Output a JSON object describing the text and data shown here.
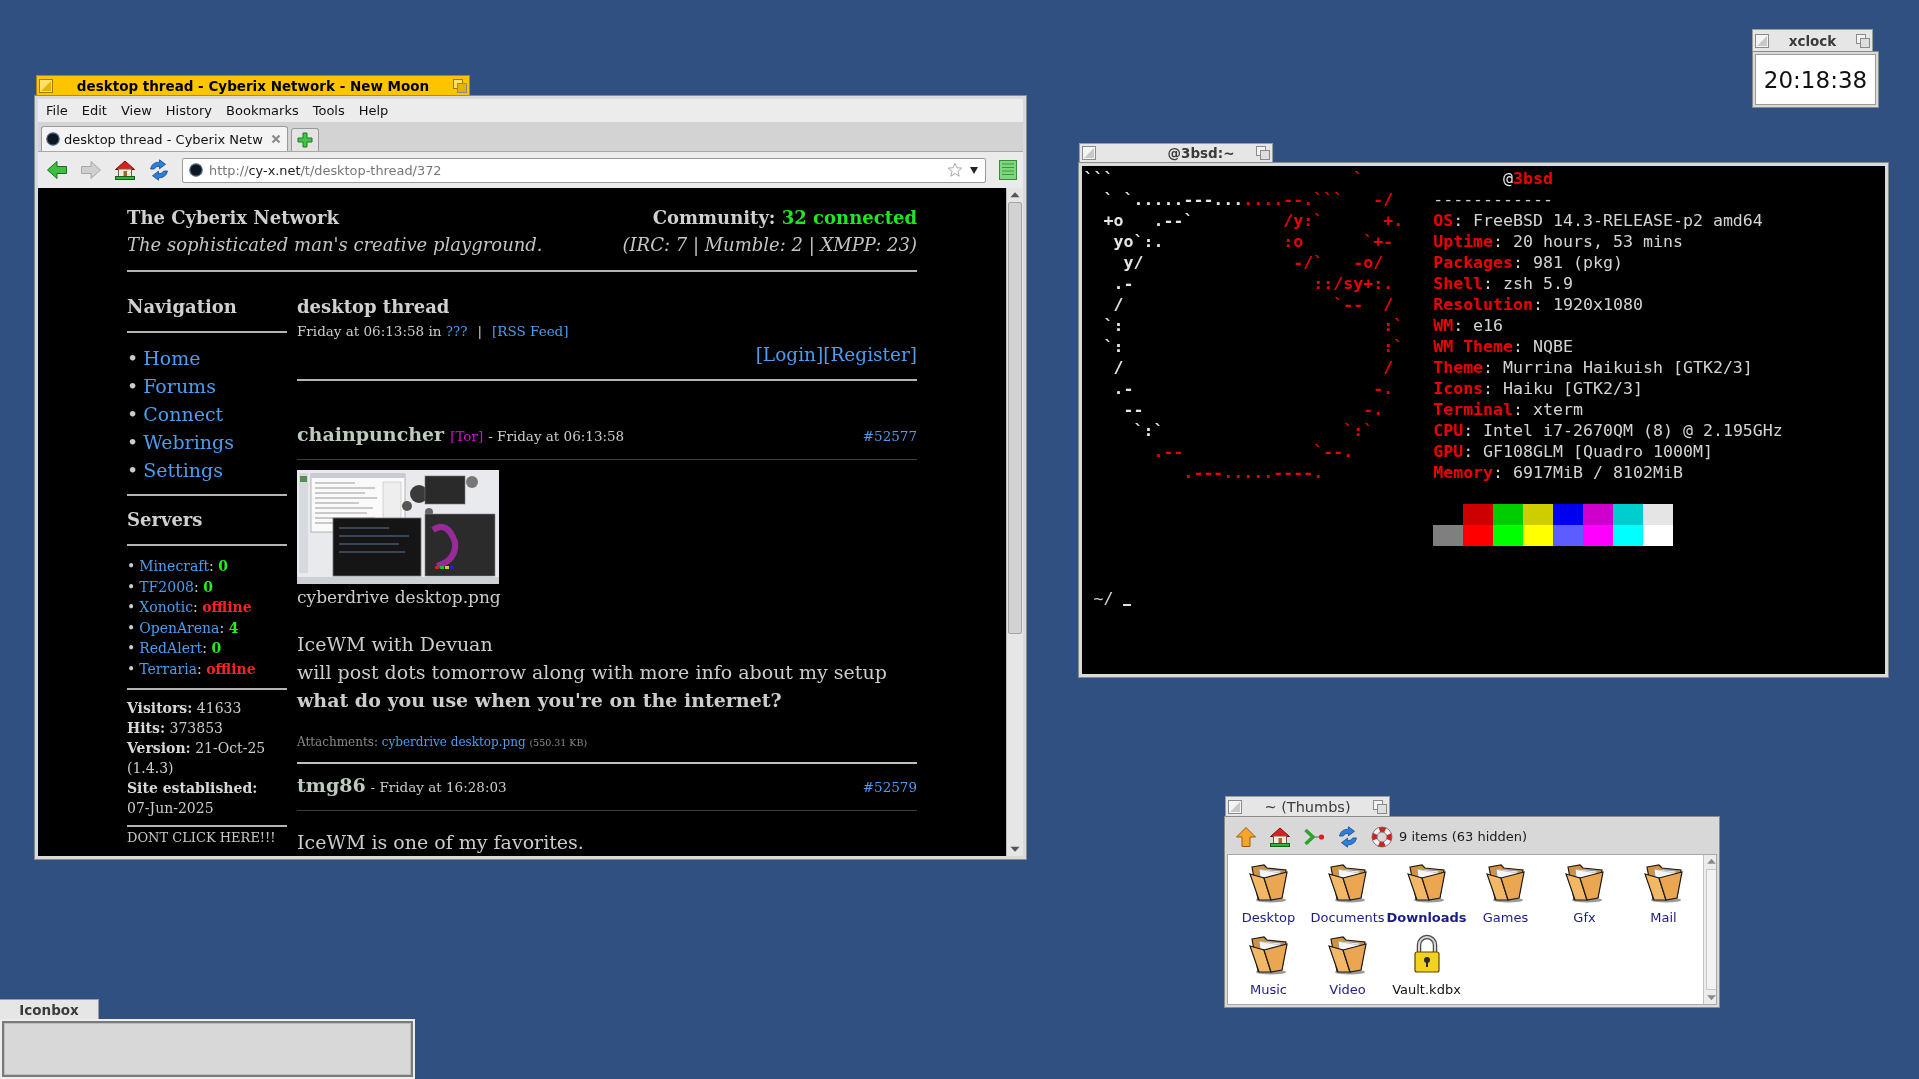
{
  "browser": {
    "focused": true,
    "title": "desktop thread - Cyberix Network - New Moon",
    "menu": [
      "File",
      "Edit",
      "View",
      "History",
      "Bookmarks",
      "Tools",
      "Help"
    ],
    "tabs": [
      {
        "label": "desktop thread - Cyberix Netw",
        "selected": true
      }
    ],
    "toolbar": [
      {
        "kind": "back",
        "disabled": false
      },
      {
        "kind": "forward",
        "disabled": true
      },
      {
        "kind": "home",
        "disabled": false
      },
      {
        "kind": "reload",
        "disabled": false
      }
    ],
    "address": {
      "scheme": "http://",
      "host": "cy-x.net",
      "path": "/t/desktop-thread/372"
    },
    "page": {
      "site_title": "The Cyberix Network",
      "tagline": "The sophisticated man's creative playground.",
      "community_label": "Community:",
      "community_count": "32 connected",
      "community_detail": "(IRC: 7 | Mumble: 2 | XMPP: 23)",
      "navigation": {
        "heading": "Navigation",
        "bullet": "•",
        "items": [
          "Home",
          "Forums",
          "Connect",
          "Webrings",
          "Settings"
        ]
      },
      "servers": {
        "heading": "Servers",
        "bullet": "•",
        "separator": ":",
        "items": [
          {
            "name": "Minecraft",
            "status": "0",
            "online": true
          },
          {
            "name": "TF2008",
            "status": "0",
            "online": true
          },
          {
            "name": "Xonotic",
            "status": "offline",
            "online": false
          },
          {
            "name": "OpenArena",
            "status": "4",
            "online": true
          },
          {
            "name": "RedAlert",
            "status": "0",
            "online": true
          },
          {
            "name": "Terraria",
            "status": "offline",
            "online": false
          }
        ]
      },
      "stats": [
        {
          "label": "Visitors:",
          "value": "41633"
        },
        {
          "label": "Hits:",
          "value": "373853"
        },
        {
          "label": "Version:",
          "value": "21-Oct-25 (1.4.3)"
        },
        {
          "label": "Site established:",
          "value": "07-Jun-2025"
        }
      ],
      "footer_link": "DONT CLICK HERE!!!",
      "thread": {
        "title": "desktop thread",
        "posted": "Friday at 06:13:58 in",
        "category": "???",
        "separator": "|",
        "feed": "[RSS Feed]",
        "login": "[Login]",
        "register": "[Register]"
      },
      "posts": [
        {
          "author": "chainpuncher",
          "tag": "[Tor]",
          "time": "- Friday at 06:13:58",
          "number": "#52577",
          "image": {
            "caption": "cyberdrive desktop.png"
          },
          "lines": [
            {
              "text": "IceWM with Devuan",
              "bold": false
            },
            {
              "text": "will post dots tomorrow along with more info about my setup",
              "bold": false
            },
            {
              "text": "what do you use when you're on the internet?",
              "bold": true
            }
          ],
          "attachments": {
            "label": "Attachments:",
            "file": "cyberdrive desktop.png",
            "size": "(550.31 KB)"
          }
        },
        {
          "author": "tmg86",
          "time": "- Friday at 16:28:03",
          "number": "#52579",
          "lines": [
            {
              "text": "IceWM is one of my favorites.",
              "bold": false
            }
          ]
        }
      ]
    }
  },
  "terminal": {
    "focused": false,
    "title": "@3bsd:~",
    "art": [
      {
        "plain": "```                        ",
        "accent": "`"
      },
      {
        "plain": "  ` `.....---...",
        "accent": "....--.```   -/"
      },
      {
        "plain": "  +o   .--`         ",
        "accent": "/y:`      +."
      },
      {
        "plain": "   yo`:.            ",
        "accent": ":o      `+-"
      },
      {
        "plain": "    y/               ",
        "accent": "-/`   -o/"
      },
      {
        "plain": "   .-                  ",
        "accent": "::/sy+:."
      },
      {
        "plain": "   /                     ",
        "accent": "`--  /"
      },
      {
        "plain": "  `:                          ",
        "accent": ":`"
      },
      {
        "plain": "  `:                          ",
        "accent": ":`"
      },
      {
        "plain": "   /                          ",
        "accent": "/"
      },
      {
        "plain": "   .-                        ",
        "accent": "-."
      },
      {
        "plain": "    --                      ",
        "accent": "-."
      },
      {
        "plain": "     `:`                  ",
        "accent": "`:`"
      },
      {
        "accent": "       .--             `--."
      },
      {
        "accent": "          .---.....----."
      }
    ],
    "info": {
      "host_prefix": "@",
      "host": "3bsd",
      "rule": "------------",
      "separator": ":",
      "items": [
        {
          "key": "OS",
          "value": "FreeBSD 14.3-RELEASE-p2 amd64"
        },
        {
          "key": "Uptime",
          "value": "20 hours, 53 mins"
        },
        {
          "key": "Packages",
          "value": "981 (pkg)"
        },
        {
          "key": "Shell",
          "value": "zsh 5.9"
        },
        {
          "key": "Resolution",
          "value": "1920x1080"
        },
        {
          "key": "WM",
          "value": "e16"
        },
        {
          "key": "WM Theme",
          "value": "NQBE"
        },
        {
          "key": "Theme",
          "value": "Murrina Haikuish [GTK2/3]"
        },
        {
          "key": "Icons",
          "value": "Haiku [GTK2/3]"
        },
        {
          "key": "Terminal",
          "value": "xterm"
        },
        {
          "key": "CPU",
          "value": "Intel i7-2670QM (8) @ 2.195GHz"
        },
        {
          "key": "GPU",
          "value": "GF108GLM [Quadro 1000M]"
        },
        {
          "key": "Memory",
          "value": "6917MiB / 8102MiB"
        }
      ]
    },
    "palette": [
      [
        {
          "color": "#cd0000"
        },
        {
          "color": "#00cd00"
        },
        {
          "color": "#cdcd00"
        },
        {
          "color": "#0000ee"
        },
        {
          "color": "#cd00cd"
        },
        {
          "color": "#00cdcd"
        },
        {
          "color": "#e5e5e5"
        }
      ],
      [
        {
          "color": "#7f7f7f"
        },
        {
          "color": "#ff0000"
        },
        {
          "color": "#00ff00"
        },
        {
          "color": "#ffff00"
        },
        {
          "color": "#5c5cff"
        },
        {
          "color": "#ff00ff"
        },
        {
          "color": "#00ffff"
        },
        {
          "color": "#ffffff"
        }
      ]
    ],
    "prompt": "~/"
  },
  "xclock": {
    "focused": false,
    "title": "xclock",
    "time": "20:18:38"
  },
  "file_manager": {
    "focused": false,
    "title": "~ (Thumbs)",
    "toolbar": [
      {
        "kind": "up"
      },
      {
        "kind": "home"
      },
      {
        "kind": "goto"
      },
      {
        "kind": "refresh"
      },
      {
        "kind": "help"
      }
    ],
    "status": "9 items (63 hidden)",
    "items": [
      {
        "name": "Desktop",
        "kind": "folder",
        "bold": false
      },
      {
        "name": "Documents",
        "kind": "folder",
        "bold": false
      },
      {
        "name": "Downloads",
        "kind": "folder",
        "bold": true
      },
      {
        "name": "Games",
        "kind": "folder",
        "bold": false
      },
      {
        "name": "Gfx",
        "kind": "folder",
        "bold": false
      },
      {
        "name": "Mail",
        "kind": "folder",
        "bold": false
      },
      {
        "name": "Music",
        "kind": "folder",
        "bold": false
      },
      {
        "name": "Video",
        "kind": "folder",
        "bold": false
      },
      {
        "name": "Vault.kdbx",
        "kind": "locked",
        "bold": false
      }
    ]
  },
  "iconbox": {
    "title": "Iconbox"
  }
}
